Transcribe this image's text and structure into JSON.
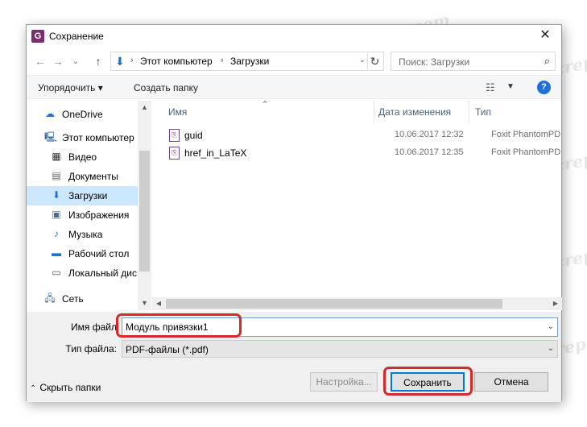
{
  "window": {
    "title": "Сохранение",
    "app_icon": "foxit-icon",
    "close_glyph": "✕"
  },
  "navbar": {
    "back_glyph": "←",
    "forward_glyph": "→",
    "recent_glyph": "⌄",
    "up_glyph": "↑",
    "breadcrumb": [
      "Этот компьютер",
      "Загрузки"
    ],
    "refresh_glyph": "↻",
    "search_placeholder": "Поиск: Загрузки",
    "search_glyph": "⌕"
  },
  "toolbar": {
    "organize_label": "Упорядочить ▾",
    "new_folder_label": "Создать папку",
    "view_glyph": "☷",
    "help_glyph": "?"
  },
  "sidebar": {
    "items": [
      {
        "label": "OneDrive",
        "icon": "cloud-icon",
        "glyph": "☁",
        "color": "#1e6fd9",
        "root": true
      },
      {
        "label": "Этот компьютер",
        "icon": "computer-icon",
        "glyph": "🖳",
        "color": "#3d6ea8",
        "root": true
      },
      {
        "label": "Видео",
        "icon": "video-icon",
        "glyph": "▦",
        "color": "#333333",
        "root": false
      },
      {
        "label": "Документы",
        "icon": "documents-icon",
        "glyph": "▤",
        "color": "#666666",
        "root": false
      },
      {
        "label": "Загрузки",
        "icon": "downloads-icon",
        "glyph": "⬇",
        "color": "#1e6fd9",
        "root": false,
        "active": true
      },
      {
        "label": "Изображения",
        "icon": "pictures-icon",
        "glyph": "▣",
        "color": "#4a6b8a",
        "root": false
      },
      {
        "label": "Музыка",
        "icon": "music-icon",
        "glyph": "♪",
        "color": "#1e6fd9",
        "root": false
      },
      {
        "label": "Рабочий стол",
        "icon": "desktop-icon",
        "glyph": "▬",
        "color": "#1e6fd9",
        "root": false
      },
      {
        "label": "Локальный дис",
        "icon": "drive-icon",
        "glyph": "▭",
        "color": "#555555",
        "root": false
      },
      {
        "label": "Сеть",
        "icon": "network-icon",
        "glyph": "🖧",
        "color": "#3d6ea8",
        "root": true
      }
    ]
  },
  "filelist": {
    "columns": {
      "name": "Имя",
      "date": "Дата изменения",
      "type": "Тип"
    },
    "rows": [
      {
        "name": "guid",
        "date": "10.06.2017 12:32",
        "type": "Foxit PhantomPD..."
      },
      {
        "name": "href_in_LaTeX",
        "date": "10.06.2017 12:35",
        "type": "Foxit PhantomPD..."
      }
    ],
    "file_glyph": "⎘"
  },
  "form": {
    "filename_label": "Имя файл",
    "filename_value": "Модуль привязки1",
    "filetype_label": "Тип файла:",
    "filetype_value": "PDF-файлы (*.pdf)",
    "dropdown_glyph": "⌄"
  },
  "footer": {
    "hide_folders_label": "Скрыть папки",
    "hide_glyph": "⌃",
    "settings_label": "Настройка...",
    "save_label": "Сохранить",
    "cancel_label": "Отмена"
  },
  "colors": {
    "accent": "#0078d7",
    "highlight": "#d62a2a",
    "selection": "#cce8ff"
  },
  "watermark": "Soringpcrepair.com"
}
